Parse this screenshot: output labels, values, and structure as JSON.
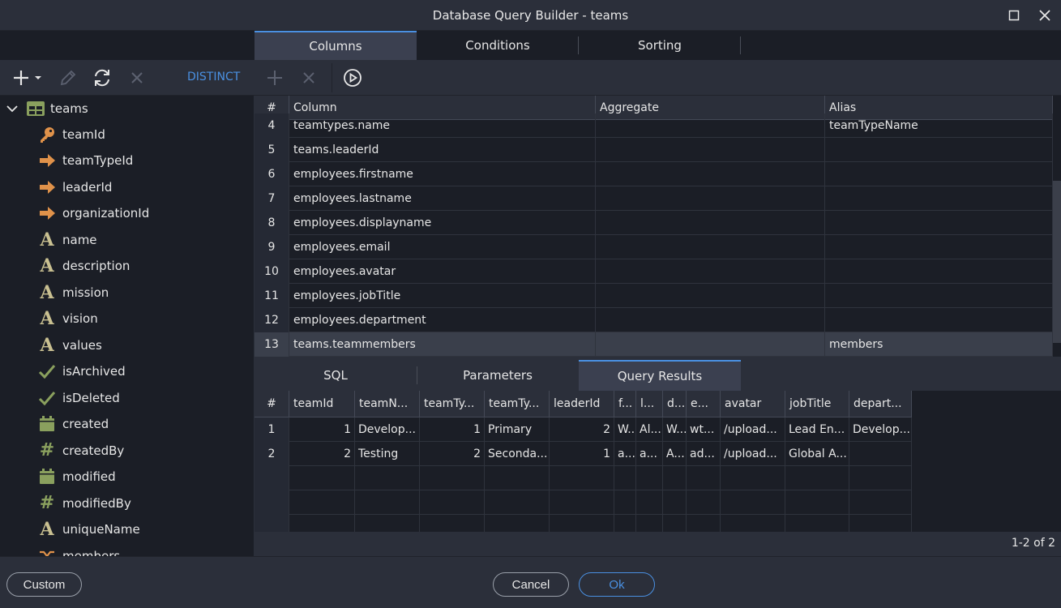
{
  "window": {
    "title": "Database Query Builder - teams"
  },
  "top_tabs": [
    {
      "label": "Columns",
      "active": true
    },
    {
      "label": "Conditions",
      "active": false
    },
    {
      "label": "Sorting",
      "active": false
    }
  ],
  "toolbar": {
    "distinct_label": "DISTINCT"
  },
  "tree": {
    "root_label": "teams",
    "items": [
      {
        "label": "teamId",
        "icon": "key-icon"
      },
      {
        "label": "teamTypeId",
        "icon": "arrow-right-icon"
      },
      {
        "label": "leaderId",
        "icon": "arrow-right-icon"
      },
      {
        "label": "organizationId",
        "icon": "arrow-right-icon"
      },
      {
        "label": "name",
        "icon": "text-icon"
      },
      {
        "label": "description",
        "icon": "text-icon"
      },
      {
        "label": "mission",
        "icon": "text-icon"
      },
      {
        "label": "vision",
        "icon": "text-icon"
      },
      {
        "label": "values",
        "icon": "text-icon"
      },
      {
        "label": "isArchived",
        "icon": "check-icon"
      },
      {
        "label": "isDeleted",
        "icon": "check-icon"
      },
      {
        "label": "created",
        "icon": "calendar-icon"
      },
      {
        "label": "createdBy",
        "icon": "hash-icon"
      },
      {
        "label": "modified",
        "icon": "calendar-icon"
      },
      {
        "label": "modifiedBy",
        "icon": "hash-icon"
      },
      {
        "label": "uniqueName",
        "icon": "text-icon"
      },
      {
        "label": "members",
        "icon": "shuffle-icon"
      }
    ]
  },
  "columns_grid": {
    "headers": [
      "#",
      "Column",
      "Aggregate",
      "Alias"
    ],
    "rows": [
      {
        "num": "4",
        "column": "teamtypes.name",
        "aggregate": "",
        "alias": "teamTypeName"
      },
      {
        "num": "5",
        "column": "teams.leaderId",
        "aggregate": "",
        "alias": ""
      },
      {
        "num": "6",
        "column": "employees.firstname",
        "aggregate": "",
        "alias": ""
      },
      {
        "num": "7",
        "column": "employees.lastname",
        "aggregate": "",
        "alias": ""
      },
      {
        "num": "8",
        "column": "employees.displayname",
        "aggregate": "",
        "alias": ""
      },
      {
        "num": "9",
        "column": "employees.email",
        "aggregate": "",
        "alias": ""
      },
      {
        "num": "10",
        "column": "employees.avatar",
        "aggregate": "",
        "alias": ""
      },
      {
        "num": "11",
        "column": "employees.jobTitle",
        "aggregate": "",
        "alias": ""
      },
      {
        "num": "12",
        "column": "employees.department",
        "aggregate": "",
        "alias": ""
      },
      {
        "num": "13",
        "column": "teams.teammembers",
        "aggregate": "",
        "alias": "members",
        "selected": true
      }
    ]
  },
  "bottom_tabs": [
    {
      "label": "SQL",
      "active": false
    },
    {
      "label": "Parameters",
      "active": false
    },
    {
      "label": "Query Results",
      "active": true
    }
  ],
  "results": {
    "headers": [
      "#",
      "teamId",
      "teamN...",
      "teamTy...",
      "teamTy...",
      "leaderId",
      "f...",
      "l...",
      "d...",
      "e...",
      "avatar",
      "jobTitle",
      "depart..."
    ],
    "rows": [
      [
        "1",
        "1",
        "Develop...",
        "1",
        "Primary",
        "2",
        "W...",
        "Al...",
        "W...",
        "wt...",
        "/upload...",
        "Lead En...",
        "Develop..."
      ],
      [
        "2",
        "2",
        "Testing",
        "2",
        "Seconda...",
        "1",
        "a...",
        "a...",
        "A...",
        "ad...",
        "/upload...",
        "Global A...",
        ""
      ]
    ],
    "status": "1-2 of 2"
  },
  "footer": {
    "custom_label": "Custom",
    "cancel_label": "Cancel",
    "ok_label": "Ok"
  },
  "colors": {
    "accent": "#4a90e2",
    "icon_orange": "#e0924a",
    "icon_green": "#8aa05e",
    "icon_text": "#c9c091"
  }
}
